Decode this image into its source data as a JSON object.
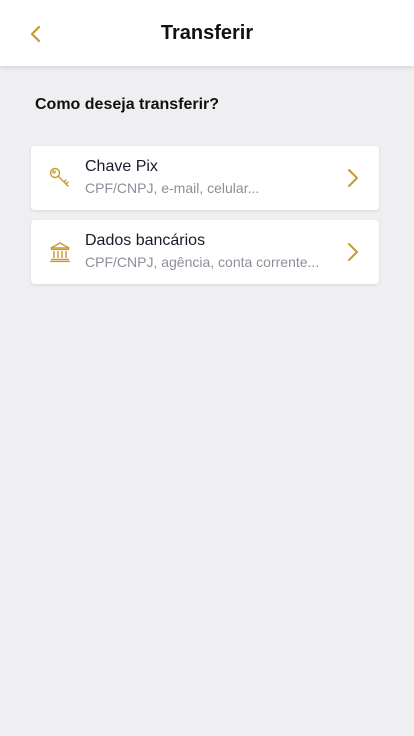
{
  "header": {
    "title": "Transferir",
    "back_icon": "chevron-left-icon"
  },
  "prompt": "Como deseja transferir?",
  "options": [
    {
      "title": "Chave Pix",
      "subtitle": "CPF/CNPJ, e-mail, celular...",
      "icon": "key-icon"
    },
    {
      "title": "Dados bancários",
      "subtitle": "CPF/CNPJ, agência, conta corrente...",
      "icon": "bank-icon"
    }
  ],
  "colors": {
    "accent": "#c79a2e",
    "background": "#efeff2",
    "card": "#ffffff",
    "text_primary": "#111111",
    "text_secondary": "#8b8f99"
  }
}
